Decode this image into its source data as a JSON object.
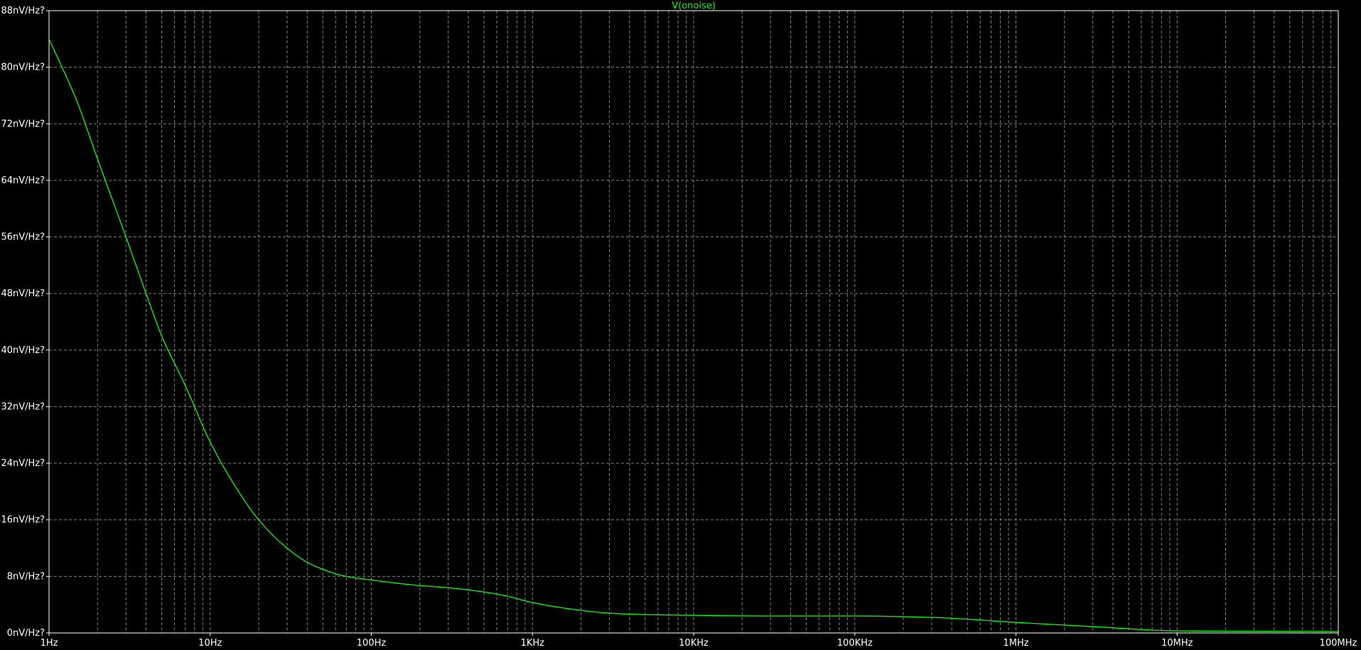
{
  "chart_data": {
    "type": "line",
    "title": "V(onoise)",
    "xscale": "log",
    "xlim": [
      1,
      100000000
    ],
    "ylim": [
      0,
      88
    ],
    "grid": true,
    "background_color": "#000000",
    "axis_color": "#ffffff",
    "grid_color": "#808080",
    "x_ticks": [
      {
        "value": 1,
        "label": "1Hz"
      },
      {
        "value": 10,
        "label": "10Hz"
      },
      {
        "value": 100,
        "label": "100Hz"
      },
      {
        "value": 1000,
        "label": "1KHz"
      },
      {
        "value": 10000,
        "label": "10KHz"
      },
      {
        "value": 100000,
        "label": "100KHz"
      },
      {
        "value": 1000000,
        "label": "1MHz"
      },
      {
        "value": 10000000,
        "label": "10MHz"
      },
      {
        "value": 100000000,
        "label": "100MHz"
      }
    ],
    "y_ticks": [
      {
        "value": 0,
        "label": "0nV/Hz?"
      },
      {
        "value": 8,
        "label": "8nV/Hz?"
      },
      {
        "value": 16,
        "label": "16nV/Hz?"
      },
      {
        "value": 24,
        "label": "24nV/Hz?"
      },
      {
        "value": 32,
        "label": "32nV/Hz?"
      },
      {
        "value": 40,
        "label": "40nV/Hz?"
      },
      {
        "value": 48,
        "label": "48nV/Hz?"
      },
      {
        "value": 56,
        "label": "56nV/Hz?"
      },
      {
        "value": 64,
        "label": "64nV/Hz?"
      },
      {
        "value": 72,
        "label": "72nV/Hz?"
      },
      {
        "value": 80,
        "label": "80nV/Hz?"
      },
      {
        "value": 88,
        "label": "88nV/Hz?"
      }
    ],
    "series": [
      {
        "name": "V(onoise)",
        "color": "#00ff00",
        "x": [
          1,
          1.5,
          2,
          3,
          4,
          5,
          7,
          10,
          15,
          20,
          30,
          40,
          50,
          70,
          100,
          150,
          200,
          300,
          500,
          700,
          1000,
          2000,
          3000,
          5000,
          10000,
          30000,
          100000,
          300000,
          1000000,
          3000000,
          10000000,
          100000000
        ],
        "y": [
          84,
          75,
          67,
          56,
          48,
          42,
          35,
          27,
          20,
          16,
          12,
          10,
          9,
          8,
          7.5,
          7,
          6.7,
          6.4,
          5.8,
          5.2,
          4.3,
          3.2,
          2.8,
          2.6,
          2.5,
          2.4,
          2.4,
          2.2,
          1.5,
          0.9,
          0.3,
          0.2
        ]
      }
    ]
  }
}
